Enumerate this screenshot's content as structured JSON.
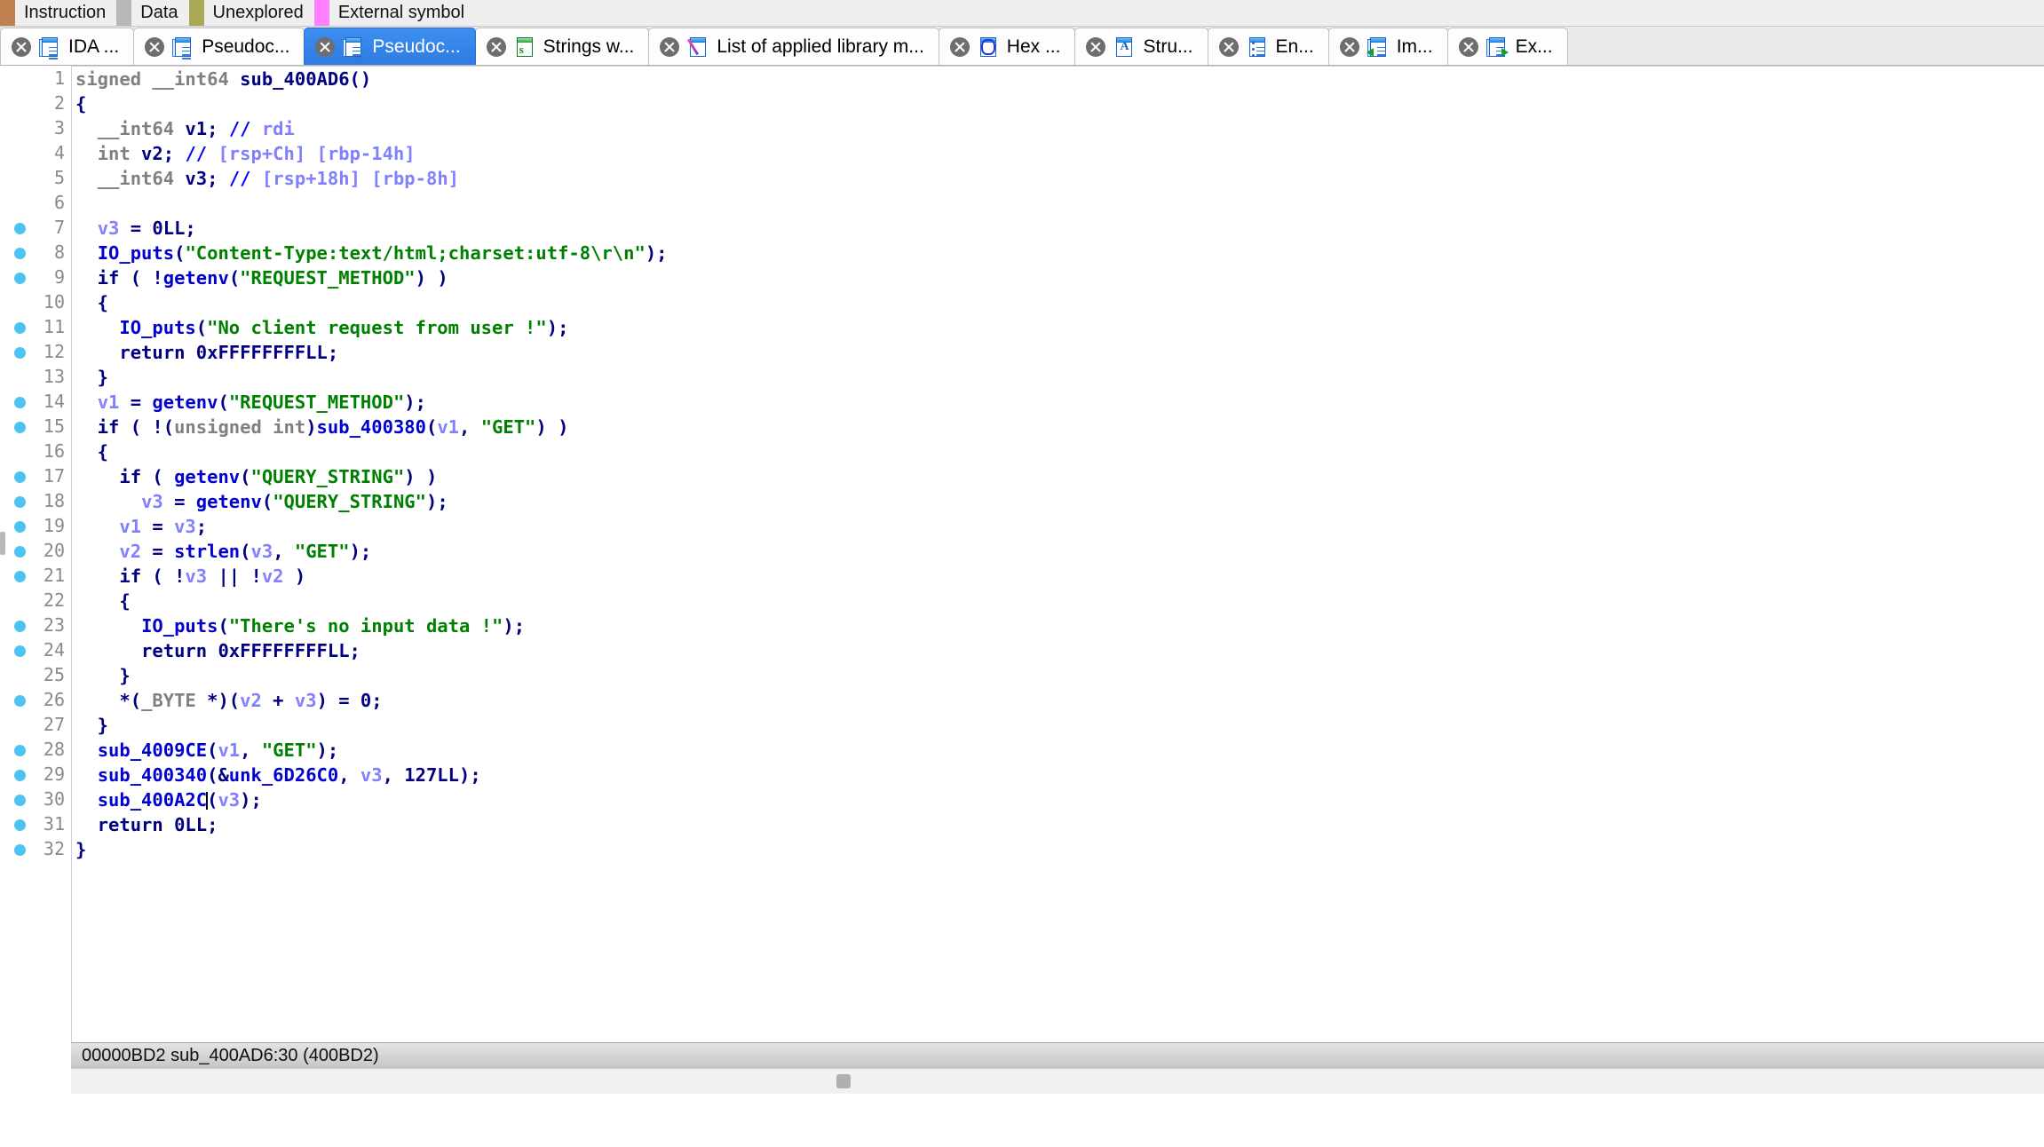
{
  "legend": {
    "items": [
      {
        "name": "instruction-swatch",
        "color": "#c08050",
        "label": "Instruction"
      },
      {
        "name": "data-swatch",
        "color": "#b8b8b8",
        "label": "Data"
      },
      {
        "name": "unexplored-swatch",
        "color": "#aaa855",
        "label": "Unexplored"
      },
      {
        "name": "external-swatch",
        "color": "#ff80ff",
        "label": "External symbol"
      }
    ]
  },
  "tabs": [
    {
      "label": "IDA ...",
      "icon": "document-icon",
      "active": false
    },
    {
      "label": "Pseudoc...",
      "icon": "pseudocode-icon",
      "active": false
    },
    {
      "label": "Pseudoc...",
      "icon": "pseudocode-icon",
      "active": true
    },
    {
      "label": "Strings w...",
      "icon": "strings-icon",
      "active": false
    },
    {
      "label": "List of applied library m...",
      "icon": "library-pen-icon",
      "active": false
    },
    {
      "label": "Hex ...",
      "icon": "hex-view-icon",
      "active": false
    },
    {
      "label": "Stru...",
      "icon": "structures-icon",
      "active": false
    },
    {
      "label": "En...",
      "icon": "enums-icon",
      "active": false
    },
    {
      "label": "Im...",
      "icon": "imports-icon",
      "active": false
    },
    {
      "label": "Ex...",
      "icon": "exports-icon",
      "active": false
    }
  ],
  "code": {
    "function_name": "sub_400AD6",
    "lines": [
      {
        "n": 1,
        "bp": false,
        "html": "<span class=\"t-kw\">signed __int64 </span><span class=\"t-plain\">sub_400AD6()</span>"
      },
      {
        "n": 2,
        "bp": false,
        "html": "<span class=\"t-plain\">{</span>"
      },
      {
        "n": 3,
        "bp": false,
        "html": "<span class=\"t-plain\">  </span><span class=\"t-kw\">__int64</span><span class=\"t-plain\"> v1; </span><span class=\"t-comslash\">// </span><span class=\"t-com\">rdi</span>"
      },
      {
        "n": 4,
        "bp": false,
        "html": "<span class=\"t-plain\">  </span><span class=\"t-kw\">int</span><span class=\"t-plain\"> v2; </span><span class=\"t-comslash\">// </span><span class=\"t-com\">[rsp+Ch] [rbp-14h]</span>"
      },
      {
        "n": 5,
        "bp": false,
        "html": "<span class=\"t-plain\">  </span><span class=\"t-kw\">__int64</span><span class=\"t-plain\"> v3; </span><span class=\"t-comslash\">// </span><span class=\"t-com\">[rsp+18h] [rbp-8h]</span>"
      },
      {
        "n": 6,
        "bp": false,
        "html": ""
      },
      {
        "n": 7,
        "bp": true,
        "html": "<span class=\"t-plain\">  </span><span class=\"t-var\">v3</span><span class=\"t-plain\"> = 0LL;</span>"
      },
      {
        "n": 8,
        "bp": true,
        "html": "<span class=\"t-plain\">  </span><span class=\"t-func\">IO_puts</span><span class=\"t-plain\">(</span><span class=\"t-str\">\"Content-Type:text/html;charset:utf-8\\r\\n\"</span><span class=\"t-plain\">);</span>"
      },
      {
        "n": 9,
        "bp": true,
        "html": "<span class=\"t-plain\">  if ( !</span><span class=\"t-func\">getenv</span><span class=\"t-plain\">(</span><span class=\"t-str\">\"REQUEST_METHOD\"</span><span class=\"t-plain\">) )</span>"
      },
      {
        "n": 10,
        "bp": false,
        "html": "<span class=\"t-plain\">  {</span>"
      },
      {
        "n": 11,
        "bp": true,
        "html": "<span class=\"t-plain\">    </span><span class=\"t-func\">IO_puts</span><span class=\"t-plain\">(</span><span class=\"t-str\">\"No client request from user !\"</span><span class=\"t-plain\">);</span>"
      },
      {
        "n": 12,
        "bp": true,
        "html": "<span class=\"t-plain\">    return 0xFFFFFFFFLL;</span>"
      },
      {
        "n": 13,
        "bp": false,
        "html": "<span class=\"t-plain\">  }</span>"
      },
      {
        "n": 14,
        "bp": true,
        "html": "<span class=\"t-plain\">  </span><span class=\"t-var\">v1</span><span class=\"t-plain\"> = </span><span class=\"t-func\">getenv</span><span class=\"t-plain\">(</span><span class=\"t-str\">\"REQUEST_METHOD\"</span><span class=\"t-plain\">);</span>"
      },
      {
        "n": 15,
        "bp": true,
        "html": "<span class=\"t-plain\">  if ( !(</span><span class=\"t-kw\">unsigned int</span><span class=\"t-plain\">)</span><span class=\"t-func\">sub_400380</span><span class=\"t-plain\">(</span><span class=\"t-var\">v1</span><span class=\"t-plain\">, </span><span class=\"t-str\">\"GET\"</span><span class=\"t-plain\">) )</span>"
      },
      {
        "n": 16,
        "bp": false,
        "html": "<span class=\"t-plain\">  {</span>"
      },
      {
        "n": 17,
        "bp": true,
        "html": "<span class=\"t-plain\">    if ( </span><span class=\"t-func\">getenv</span><span class=\"t-plain\">(</span><span class=\"t-str\">\"QUERY_STRING\"</span><span class=\"t-plain\">) )</span>"
      },
      {
        "n": 18,
        "bp": true,
        "html": "<span class=\"t-plain\">      </span><span class=\"t-var\">v3</span><span class=\"t-plain\"> = </span><span class=\"t-func\">getenv</span><span class=\"t-plain\">(</span><span class=\"t-str\">\"QUERY_STRING\"</span><span class=\"t-plain\">);</span>"
      },
      {
        "n": 19,
        "bp": true,
        "html": "<span class=\"t-plain\">    </span><span class=\"t-var\">v1</span><span class=\"t-plain\"> = </span><span class=\"t-var\">v3</span><span class=\"t-plain\">;</span>"
      },
      {
        "n": 20,
        "bp": true,
        "html": "<span class=\"t-plain\">    </span><span class=\"t-var\">v2</span><span class=\"t-plain\"> = </span><span class=\"t-func\">strlen</span><span class=\"t-plain\">(</span><span class=\"t-var\">v3</span><span class=\"t-plain\">, </span><span class=\"t-str\">\"GET\"</span><span class=\"t-plain\">);</span>"
      },
      {
        "n": 21,
        "bp": true,
        "html": "<span class=\"t-plain\">    if ( !</span><span class=\"t-var\">v3</span><span class=\"t-plain\"> || !</span><span class=\"t-var\">v2</span><span class=\"t-plain\"> )</span>"
      },
      {
        "n": 22,
        "bp": false,
        "html": "<span class=\"t-plain\">    {</span>"
      },
      {
        "n": 23,
        "bp": true,
        "html": "<span class=\"t-plain\">      </span><span class=\"t-func\">IO_puts</span><span class=\"t-plain\">(</span><span class=\"t-str\">\"There's no input data !\"</span><span class=\"t-plain\">);</span>"
      },
      {
        "n": 24,
        "bp": true,
        "html": "<span class=\"t-plain\">      return 0xFFFFFFFFLL;</span>"
      },
      {
        "n": 25,
        "bp": false,
        "html": "<span class=\"t-plain\">    }</span>"
      },
      {
        "n": 26,
        "bp": true,
        "html": "<span class=\"t-plain\">    *(</span><span class=\"t-kw\">_BYTE </span><span class=\"t-plain\">*)(</span><span class=\"t-var\">v2</span><span class=\"t-plain\"> + </span><span class=\"t-var\">v3</span><span class=\"t-plain\">) = 0;</span>"
      },
      {
        "n": 27,
        "bp": false,
        "html": "<span class=\"t-plain\">  }</span>"
      },
      {
        "n": 28,
        "bp": true,
        "html": "<span class=\"t-plain\">  </span><span class=\"t-func\">sub_4009CE</span><span class=\"t-plain\">(</span><span class=\"t-var\">v1</span><span class=\"t-plain\">, </span><span class=\"t-str\">\"GET\"</span><span class=\"t-plain\">);</span>"
      },
      {
        "n": 29,
        "bp": true,
        "html": "<span class=\"t-plain\">  </span><span class=\"t-func\">sub_400340</span><span class=\"t-plain\">(&amp;</span><span class=\"t-func\">unk_6D26C0</span><span class=\"t-plain\">, </span><span class=\"t-var\">v3</span><span class=\"t-plain\">, 127LL);</span>"
      },
      {
        "n": 30,
        "bp": true,
        "html": "<span class=\"t-plain\">  </span><span class=\"t-func\">sub_400A2C</span><span class=\"caret\"></span><span class=\"t-plain\">(</span><span class=\"t-var\">v3</span><span class=\"t-plain\">);</span>"
      },
      {
        "n": 31,
        "bp": true,
        "html": "<span class=\"t-plain\">  return 0LL;</span>"
      },
      {
        "n": 32,
        "bp": true,
        "html": "<span class=\"t-plain\">}</span>"
      }
    ],
    "plain_text": [
      "signed __int64 sub_400AD6()",
      "{",
      "  __int64 v1; // rdi",
      "  int v2; // [rsp+Ch] [rbp-14h]",
      "  __int64 v3; // [rsp+18h] [rbp-8h]",
      "",
      "  v3 = 0LL;",
      "  IO_puts(\"Content-Type:text/html;charset:utf-8\\r\\n\");",
      "  if ( !getenv(\"REQUEST_METHOD\") )",
      "  {",
      "    IO_puts(\"No client request from user !\");",
      "    return 0xFFFFFFFFLL;",
      "  }",
      "  v1 = getenv(\"REQUEST_METHOD\");",
      "  if ( !(unsigned int)sub_400380(v1, \"GET\") )",
      "  {",
      "    if ( getenv(\"QUERY_STRING\") )",
      "      v3 = getenv(\"QUERY_STRING\");",
      "    v1 = v3;",
      "    v2 = strlen(v3, \"GET\");",
      "    if ( !v3 || !v2 )",
      "    {",
      "      IO_puts(\"There's no input data !\");",
      "      return 0xFFFFFFFFLL;",
      "    }",
      "    *(_BYTE *)(v2 + v3) = 0;",
      "  }",
      "  sub_4009CE(v1, \"GET\");",
      "  sub_400340(&unk_6D26C0, v3, 127LL);",
      "  sub_400A2C(v3);",
      "  return 0LL;",
      "}"
    ]
  },
  "status": {
    "text": "00000BD2  sub_400AD6:30 (400BD2)",
    "offset": "00000BD2",
    "location": "sub_400AD6:30",
    "address": "400BD2"
  },
  "colors": {
    "active_tab": "#2f7ae4",
    "string": "#008000",
    "function": "#0000d0",
    "local_var": "#8080ff",
    "keyword": "#808080",
    "breakpoint_dot": "#4ec3f0"
  }
}
